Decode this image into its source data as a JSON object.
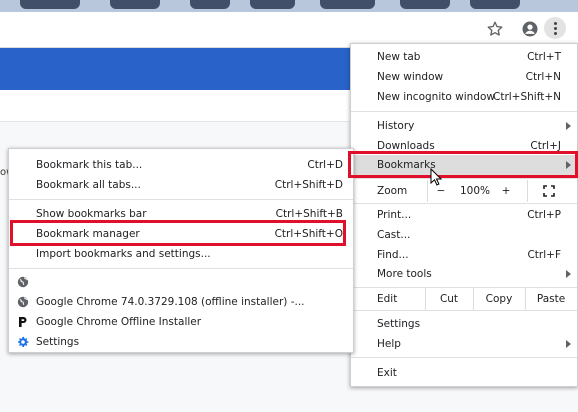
{
  "main_menu": {
    "new_tab": {
      "label": "New tab",
      "shortcut": "Ctrl+T"
    },
    "new_window": {
      "label": "New window",
      "shortcut": "Ctrl+N"
    },
    "new_incognito": {
      "label": "New incognito window",
      "shortcut": "Ctrl+Shift+N"
    },
    "history": {
      "label": "History"
    },
    "downloads": {
      "label": "Downloads",
      "shortcut": "Ctrl+J"
    },
    "bookmarks": {
      "label": "Bookmarks"
    },
    "zoom": {
      "label": "Zoom",
      "minus": "−",
      "level": "100%",
      "plus": "+"
    },
    "print": {
      "label": "Print...",
      "shortcut": "Ctrl+P"
    },
    "cast": {
      "label": "Cast..."
    },
    "find": {
      "label": "Find...",
      "shortcut": "Ctrl+F"
    },
    "more_tools": {
      "label": "More tools"
    },
    "edit": {
      "label": "Edit",
      "cut": "Cut",
      "copy": "Copy",
      "paste": "Paste"
    },
    "settings": {
      "label": "Settings"
    },
    "help": {
      "label": "Help"
    },
    "exit": {
      "label": "Exit"
    }
  },
  "bookmarks_menu": {
    "bookmark_tab": {
      "label": "Bookmark this tab...",
      "shortcut": "Ctrl+D"
    },
    "bookmark_all": {
      "label": "Bookmark all tabs...",
      "shortcut": "Ctrl+Shift+D"
    },
    "show_bar": {
      "label": "Show bookmarks bar",
      "shortcut": "Ctrl+Shift+B"
    },
    "manager": {
      "label": "Bookmark manager",
      "shortcut": "Ctrl+Shift+O"
    },
    "import": {
      "label": "Import bookmarks and settings..."
    },
    "items": [
      {
        "label": "",
        "icon": "globe-icon"
      },
      {
        "label": "Google Chrome 74.0.3729.108 (offline installer) -...",
        "icon": "globe-icon"
      },
      {
        "label": "Google Chrome Offline Installer",
        "icon": "p-logo-icon"
      },
      {
        "label": "Settings",
        "icon": "gear-icon"
      }
    ]
  },
  "page": {
    "fragment": "ow"
  },
  "colors": {
    "highlight_box": "#e0102a",
    "banner": "#2962c8",
    "hover_row": "#dddddd"
  }
}
